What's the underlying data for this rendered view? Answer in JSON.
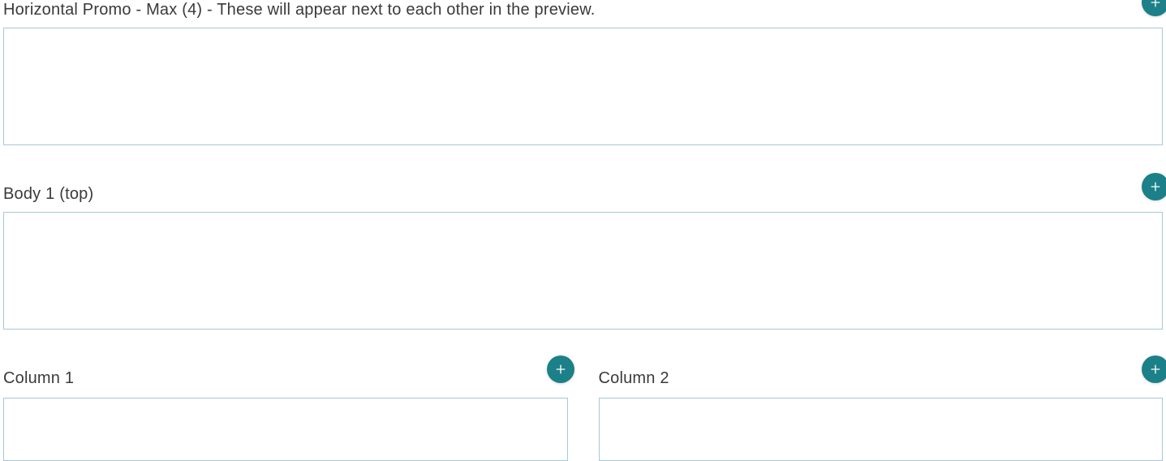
{
  "sections": {
    "horizontal_promo": {
      "label": "Horizontal Promo - Max (4) - These will appear next to each other in the preview."
    },
    "body1": {
      "label": "Body 1 (top)"
    },
    "column1": {
      "label": "Column 1"
    },
    "column2": {
      "label": "Column 2"
    }
  },
  "icons": {
    "add": "plus-icon"
  },
  "colors": {
    "accent": "#1c8088",
    "border": "#a7c9d6",
    "text": "#3a3a3a"
  }
}
